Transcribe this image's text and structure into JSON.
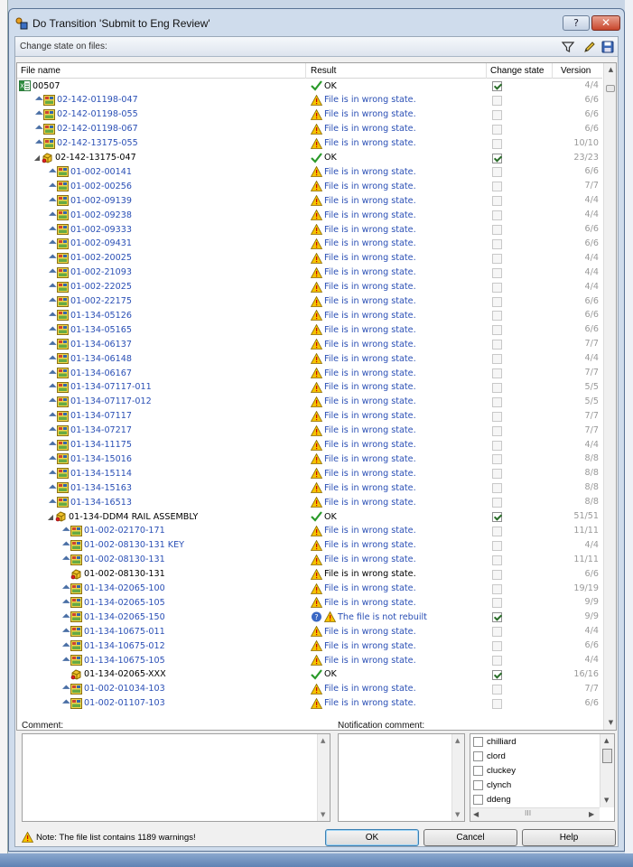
{
  "window": {
    "title": "Do Transition 'Submit to Eng Review'",
    "help_label": "?",
    "close_label": "✕"
  },
  "toolbar": {
    "label": "Change state on files:",
    "icons": [
      "filter-icon",
      "edit-icon",
      "save-icon"
    ]
  },
  "columns": {
    "file_name": "File name",
    "result": "Result",
    "change_state": "Change state",
    "version": "Version"
  },
  "rows": [
    {
      "indent": 0,
      "expander": "",
      "arrow": false,
      "icon": "drawing",
      "name": "00507",
      "kind": "asm",
      "result": "OK",
      "status": "ok",
      "checked": true,
      "enabled": true,
      "version": "4/4"
    },
    {
      "indent": 1,
      "expander": "",
      "arrow": true,
      "icon": "part",
      "name": "02-142-01198-047",
      "kind": "part",
      "result": "File is in wrong state.",
      "status": "warn",
      "checked": false,
      "enabled": false,
      "version": "6/6"
    },
    {
      "indent": 1,
      "expander": "",
      "arrow": true,
      "icon": "part",
      "name": "02-142-01198-055",
      "kind": "part",
      "result": "File is in wrong state.",
      "status": "warn",
      "checked": false,
      "enabled": false,
      "version": "6/6"
    },
    {
      "indent": 1,
      "expander": "",
      "arrow": true,
      "icon": "part",
      "name": "02-142-01198-067",
      "kind": "part",
      "result": "File is in wrong state.",
      "status": "warn",
      "checked": false,
      "enabled": false,
      "version": "6/6"
    },
    {
      "indent": 1,
      "expander": "",
      "arrow": true,
      "icon": "part",
      "name": "02-142-13175-055",
      "kind": "part",
      "result": "File is in wrong state.",
      "status": "warn",
      "checked": false,
      "enabled": false,
      "version": "10/10"
    },
    {
      "indent": 1,
      "expander": "◢",
      "arrow": false,
      "icon": "assembly",
      "name": "02-142-13175-047",
      "kind": "asm",
      "result": "OK",
      "status": "ok",
      "checked": true,
      "enabled": true,
      "version": "23/23"
    },
    {
      "indent": 2,
      "expander": "",
      "arrow": true,
      "icon": "part",
      "name": "01-002-00141",
      "kind": "part",
      "result": "File is in wrong state.",
      "status": "warn",
      "checked": false,
      "enabled": false,
      "version": "6/6"
    },
    {
      "indent": 2,
      "expander": "",
      "arrow": true,
      "icon": "part",
      "name": "01-002-00256",
      "kind": "part",
      "result": "File is in wrong state.",
      "status": "warn",
      "checked": false,
      "enabled": false,
      "version": "7/7"
    },
    {
      "indent": 2,
      "expander": "",
      "arrow": true,
      "icon": "part",
      "name": "01-002-09139",
      "kind": "part",
      "result": "File is in wrong state.",
      "status": "warn",
      "checked": false,
      "enabled": false,
      "version": "4/4"
    },
    {
      "indent": 2,
      "expander": "",
      "arrow": true,
      "icon": "part",
      "name": "01-002-09238",
      "kind": "part",
      "result": "File is in wrong state.",
      "status": "warn",
      "checked": false,
      "enabled": false,
      "version": "4/4"
    },
    {
      "indent": 2,
      "expander": "",
      "arrow": true,
      "icon": "part",
      "name": "01-002-09333",
      "kind": "part",
      "result": "File is in wrong state.",
      "status": "warn",
      "checked": false,
      "enabled": false,
      "version": "6/6"
    },
    {
      "indent": 2,
      "expander": "",
      "arrow": true,
      "icon": "part",
      "name": "01-002-09431",
      "kind": "part",
      "result": "File is in wrong state.",
      "status": "warn",
      "checked": false,
      "enabled": false,
      "version": "6/6"
    },
    {
      "indent": 2,
      "expander": "",
      "arrow": true,
      "icon": "part",
      "name": "01-002-20025",
      "kind": "part",
      "result": "File is in wrong state.",
      "status": "warn",
      "checked": false,
      "enabled": false,
      "version": "4/4"
    },
    {
      "indent": 2,
      "expander": "",
      "arrow": true,
      "icon": "part",
      "name": "01-002-21093",
      "kind": "part",
      "result": "File is in wrong state.",
      "status": "warn",
      "checked": false,
      "enabled": false,
      "version": "4/4"
    },
    {
      "indent": 2,
      "expander": "",
      "arrow": true,
      "icon": "part",
      "name": "01-002-22025",
      "kind": "part",
      "result": "File is in wrong state.",
      "status": "warn",
      "checked": false,
      "enabled": false,
      "version": "4/4"
    },
    {
      "indent": 2,
      "expander": "",
      "arrow": true,
      "icon": "part",
      "name": "01-002-22175",
      "kind": "part",
      "result": "File is in wrong state.",
      "status": "warn",
      "checked": false,
      "enabled": false,
      "version": "6/6"
    },
    {
      "indent": 2,
      "expander": "",
      "arrow": true,
      "icon": "part",
      "name": "01-134-05126",
      "kind": "part",
      "result": "File is in wrong state.",
      "status": "warn",
      "checked": false,
      "enabled": false,
      "version": "6/6"
    },
    {
      "indent": 2,
      "expander": "",
      "arrow": true,
      "icon": "part",
      "name": "01-134-05165",
      "kind": "part",
      "result": "File is in wrong state.",
      "status": "warn",
      "checked": false,
      "enabled": false,
      "version": "6/6"
    },
    {
      "indent": 2,
      "expander": "",
      "arrow": true,
      "icon": "part",
      "name": "01-134-06137",
      "kind": "part",
      "result": "File is in wrong state.",
      "status": "warn",
      "checked": false,
      "enabled": false,
      "version": "7/7"
    },
    {
      "indent": 2,
      "expander": "",
      "arrow": true,
      "icon": "part",
      "name": "01-134-06148",
      "kind": "part",
      "result": "File is in wrong state.",
      "status": "warn",
      "checked": false,
      "enabled": false,
      "version": "4/4"
    },
    {
      "indent": 2,
      "expander": "",
      "arrow": true,
      "icon": "part",
      "name": "01-134-06167",
      "kind": "part",
      "result": "File is in wrong state.",
      "status": "warn",
      "checked": false,
      "enabled": false,
      "version": "7/7"
    },
    {
      "indent": 2,
      "expander": "",
      "arrow": true,
      "icon": "part",
      "name": "01-134-07117-011",
      "kind": "part",
      "result": "File is in wrong state.",
      "status": "warn",
      "checked": false,
      "enabled": false,
      "version": "5/5"
    },
    {
      "indent": 2,
      "expander": "",
      "arrow": true,
      "icon": "part",
      "name": "01-134-07117-012",
      "kind": "part",
      "result": "File is in wrong state.",
      "status": "warn",
      "checked": false,
      "enabled": false,
      "version": "5/5"
    },
    {
      "indent": 2,
      "expander": "",
      "arrow": true,
      "icon": "part",
      "name": "01-134-07117",
      "kind": "part",
      "result": "File is in wrong state.",
      "status": "warn",
      "checked": false,
      "enabled": false,
      "version": "7/7"
    },
    {
      "indent": 2,
      "expander": "",
      "arrow": true,
      "icon": "part",
      "name": "01-134-07217",
      "kind": "part",
      "result": "File is in wrong state.",
      "status": "warn",
      "checked": false,
      "enabled": false,
      "version": "7/7"
    },
    {
      "indent": 2,
      "expander": "",
      "arrow": true,
      "icon": "part",
      "name": "01-134-11175",
      "kind": "part",
      "result": "File is in wrong state.",
      "status": "warn",
      "checked": false,
      "enabled": false,
      "version": "4/4"
    },
    {
      "indent": 2,
      "expander": "",
      "arrow": true,
      "icon": "part",
      "name": "01-134-15016",
      "kind": "part",
      "result": "File is in wrong state.",
      "status": "warn",
      "checked": false,
      "enabled": false,
      "version": "8/8"
    },
    {
      "indent": 2,
      "expander": "",
      "arrow": true,
      "icon": "part",
      "name": "01-134-15114",
      "kind": "part",
      "result": "File is in wrong state.",
      "status": "warn",
      "checked": false,
      "enabled": false,
      "version": "8/8"
    },
    {
      "indent": 2,
      "expander": "",
      "arrow": true,
      "icon": "part",
      "name": "01-134-15163",
      "kind": "part",
      "result": "File is in wrong state.",
      "status": "warn",
      "checked": false,
      "enabled": false,
      "version": "8/8"
    },
    {
      "indent": 2,
      "expander": "",
      "arrow": true,
      "icon": "part",
      "name": "01-134-16513",
      "kind": "part",
      "result": "File is in wrong state.",
      "status": "warn",
      "checked": false,
      "enabled": false,
      "version": "8/8"
    },
    {
      "indent": 2,
      "expander": "◢",
      "arrow": false,
      "icon": "assembly",
      "name": "01-134-DDM4 RAIL ASSEMBLY",
      "kind": "asm",
      "result": "OK",
      "status": "ok",
      "checked": true,
      "enabled": true,
      "version": "51/51"
    },
    {
      "indent": 3,
      "expander": "",
      "arrow": true,
      "icon": "part",
      "name": "01-002-02170-171",
      "kind": "part",
      "result": "File is in wrong state.",
      "status": "warn",
      "checked": false,
      "enabled": false,
      "version": "11/11"
    },
    {
      "indent": 3,
      "expander": "",
      "arrow": true,
      "icon": "part",
      "name": "01-002-08130-131 KEY",
      "kind": "part",
      "result": "File is in wrong state.",
      "status": "warn",
      "checked": false,
      "enabled": false,
      "version": "4/4"
    },
    {
      "indent": 3,
      "expander": "",
      "arrow": true,
      "icon": "part",
      "name": "01-002-08130-131",
      "kind": "part",
      "result": "File is in wrong state.",
      "status": "warn",
      "checked": false,
      "enabled": false,
      "version": "11/11"
    },
    {
      "indent": 3,
      "expander": "",
      "arrow": false,
      "icon": "assembly",
      "name": "01-002-08130-131",
      "kind": "asm",
      "result": "File is in wrong state.",
      "status": "warn-dark",
      "checked": false,
      "enabled": false,
      "version": "6/6"
    },
    {
      "indent": 3,
      "expander": "",
      "arrow": true,
      "icon": "part",
      "name": "01-134-02065-100",
      "kind": "part",
      "result": "File is in wrong state.",
      "status": "warn",
      "checked": false,
      "enabled": false,
      "version": "19/19"
    },
    {
      "indent": 3,
      "expander": "",
      "arrow": true,
      "icon": "part",
      "name": "01-134-02065-105",
      "kind": "part",
      "result": "File is in wrong state.",
      "status": "warn",
      "checked": false,
      "enabled": false,
      "version": "9/9"
    },
    {
      "indent": 3,
      "expander": "",
      "arrow": true,
      "icon": "part",
      "name": "01-134-02065-150",
      "kind": "part",
      "result": "The file is not rebuilt",
      "status": "rebuild",
      "checked": true,
      "enabled": true,
      "version": "9/9"
    },
    {
      "indent": 3,
      "expander": "",
      "arrow": true,
      "icon": "part",
      "name": "01-134-10675-011",
      "kind": "part",
      "result": "File is in wrong state.",
      "status": "warn",
      "checked": false,
      "enabled": false,
      "version": "4/4"
    },
    {
      "indent": 3,
      "expander": "",
      "arrow": true,
      "icon": "part",
      "name": "01-134-10675-012",
      "kind": "part",
      "result": "File is in wrong state.",
      "status": "warn",
      "checked": false,
      "enabled": false,
      "version": "6/6"
    },
    {
      "indent": 3,
      "expander": "",
      "arrow": true,
      "icon": "part",
      "name": "01-134-10675-105",
      "kind": "part",
      "result": "File is in wrong state.",
      "status": "warn",
      "checked": false,
      "enabled": false,
      "version": "4/4"
    },
    {
      "indent": 3,
      "expander": "",
      "arrow": false,
      "icon": "assembly",
      "name": "01-134-02065-XXX",
      "kind": "asm",
      "result": "OK",
      "status": "ok",
      "checked": true,
      "enabled": true,
      "version": "16/16"
    },
    {
      "indent": 3,
      "expander": "",
      "arrow": true,
      "icon": "part",
      "name": "01-002-01034-103",
      "kind": "part",
      "result": "File is in wrong state.",
      "status": "warn",
      "checked": false,
      "enabled": false,
      "version": "7/7"
    },
    {
      "indent": 3,
      "expander": "",
      "arrow": true,
      "icon": "part",
      "name": "01-002-01107-103",
      "kind": "part",
      "result": "File is in wrong state.",
      "status": "warn",
      "checked": false,
      "enabled": false,
      "version": "6/6"
    }
  ],
  "comment": {
    "label": "Comment:",
    "value": ""
  },
  "notification": {
    "label": "Notification comment:",
    "value": "",
    "users": [
      "chilliard",
      "clord",
      "cluckey",
      "clynch",
      "ddeng"
    ],
    "hscroll_grip": "III"
  },
  "buttons": {
    "ok": "OK",
    "cancel": "Cancel",
    "help": "Help"
  },
  "note": "Note: The file list contains 1189 warnings!",
  "colors": {
    "link_blue": "#2a4fb5",
    "ok_green": "#2a9a2a",
    "warn_yellow": "#f5c400"
  }
}
